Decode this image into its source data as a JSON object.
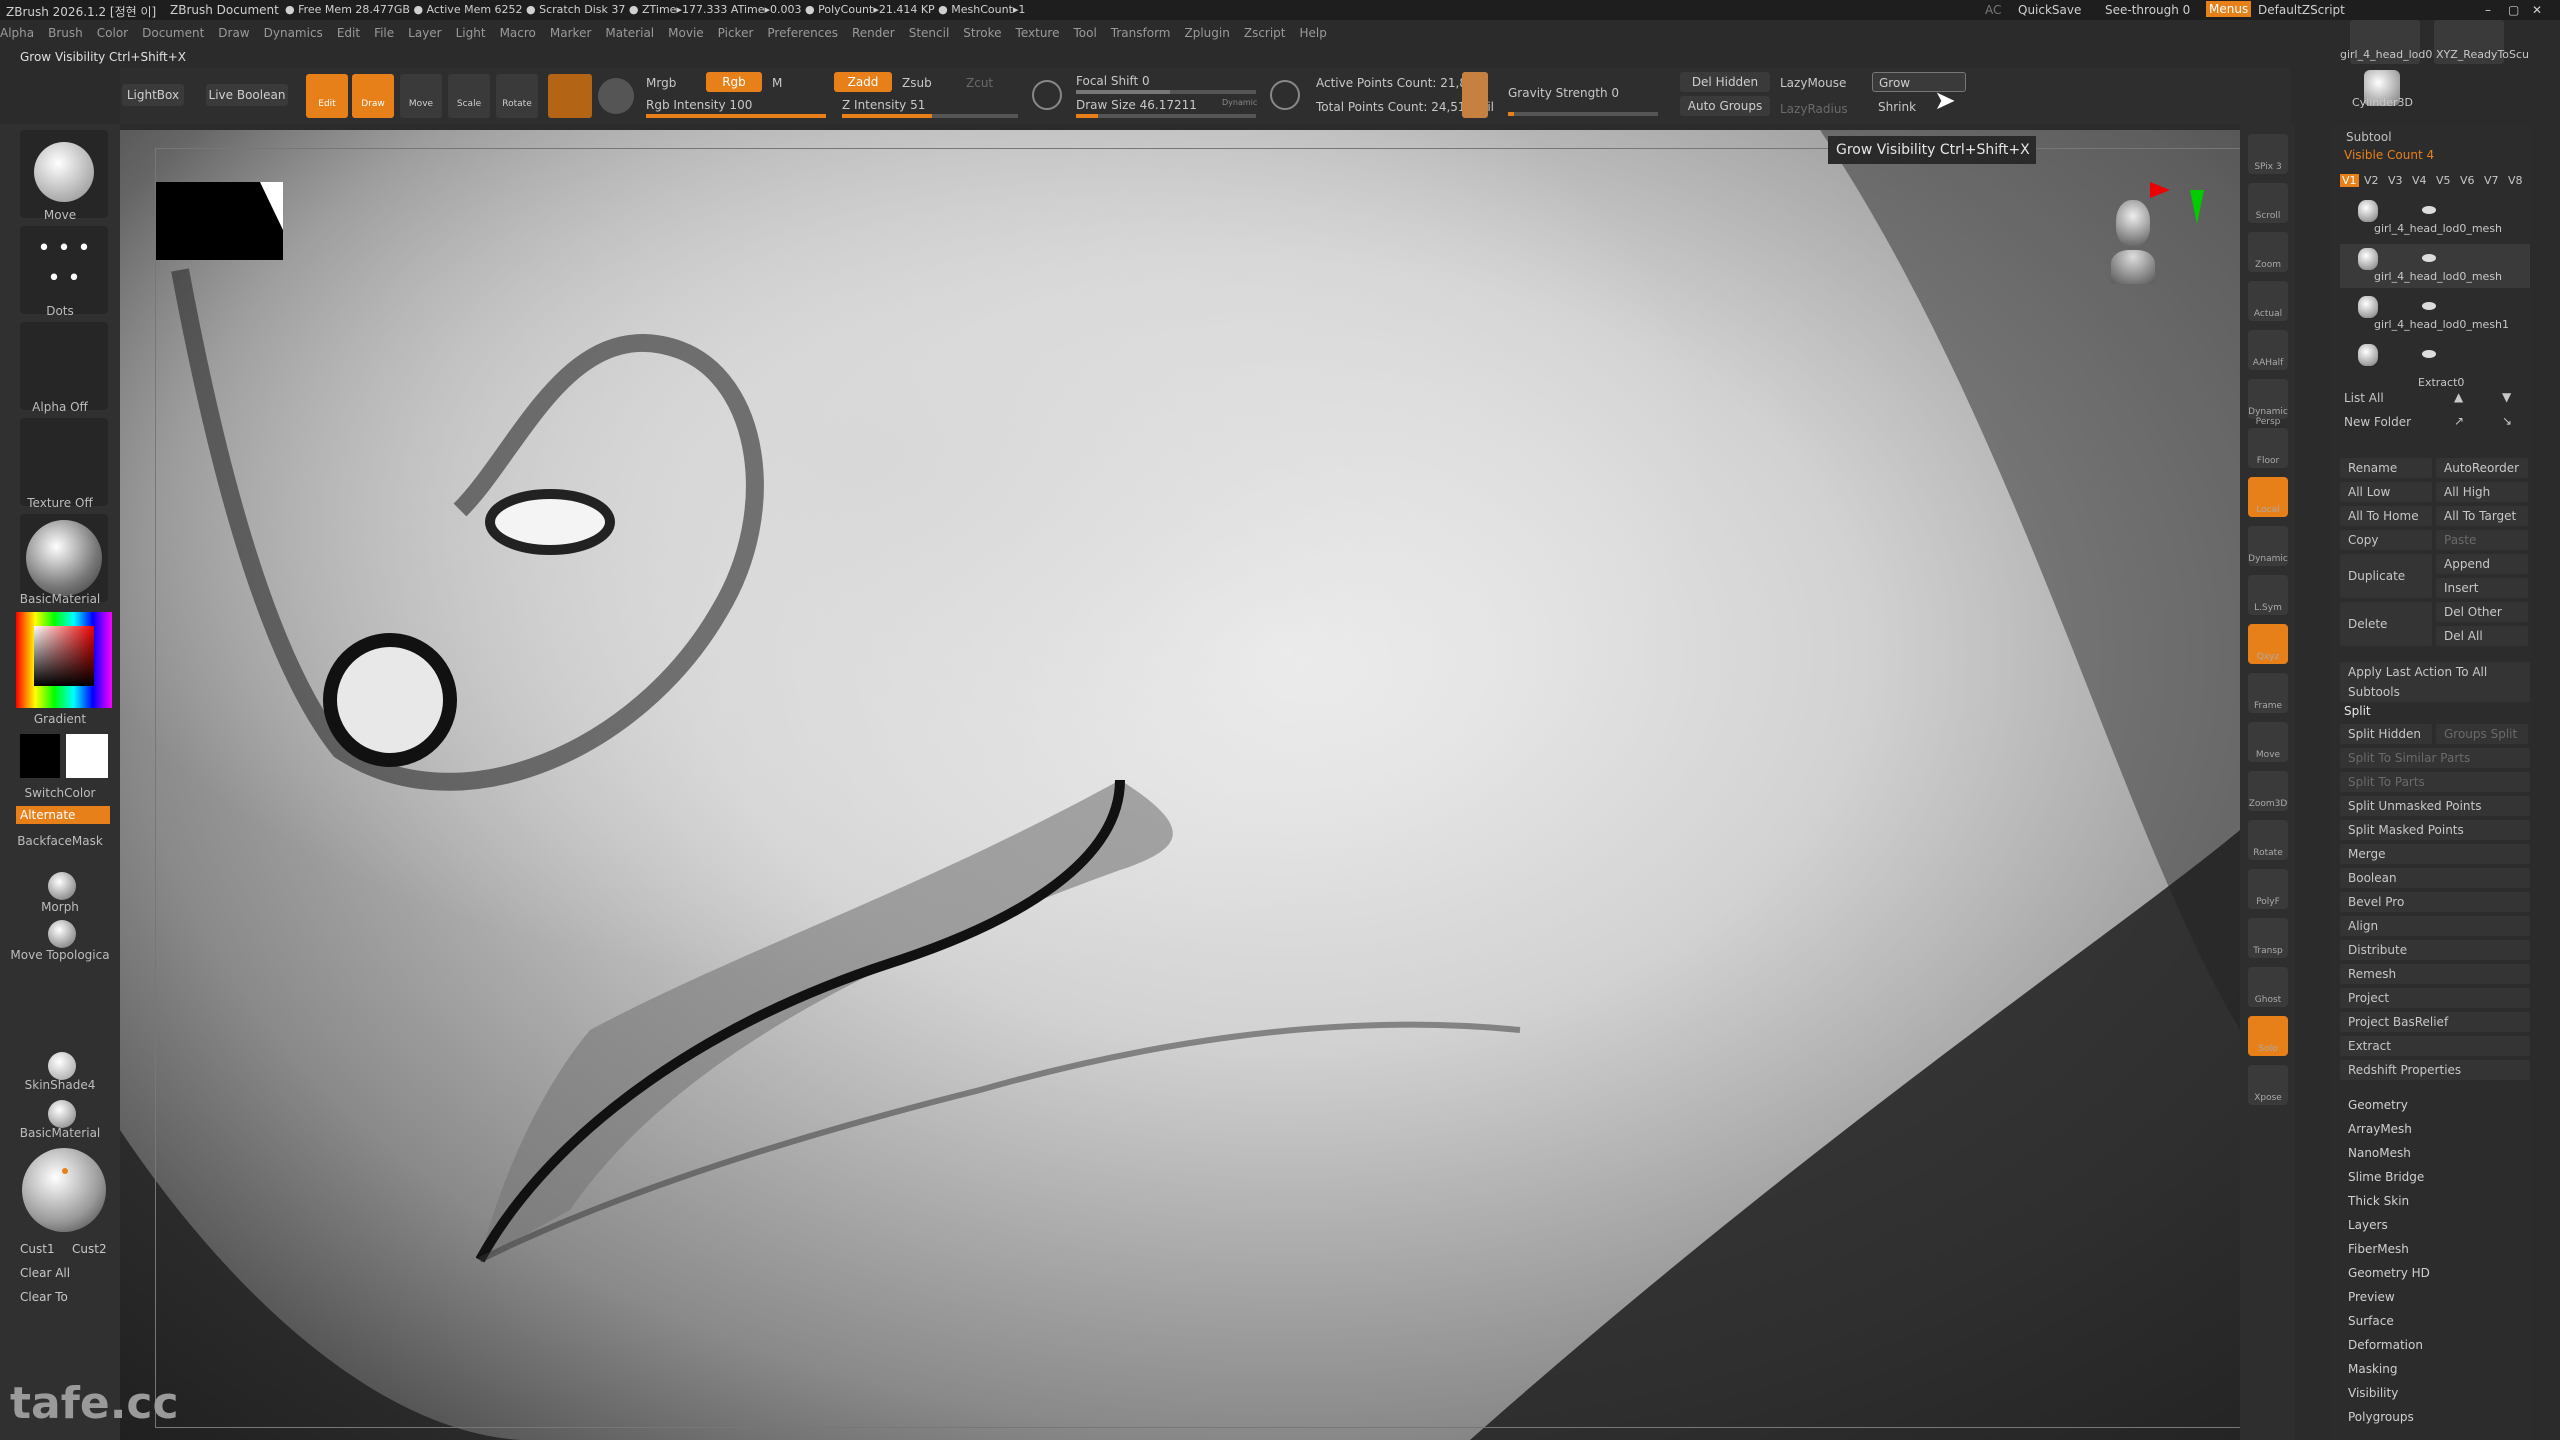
{
  "titlebar": {
    "app": "ZBrush 2026.1.2 [정현 이]",
    "doc": "ZBrush Document",
    "stats": "● Free Mem 28.477GB ● Active Mem 6252 ● Scratch Disk 37 ● ZTime▸177.333 ATime▸0.003 ● PolyCount▸21.414 KP ● MeshCount▸1",
    "ac": "AC",
    "quicksave": "QuickSave",
    "see_through": "See-through  0",
    "menus": "Menus",
    "script": "DefaultZScript"
  },
  "menubar": [
    "Alpha",
    "Brush",
    "Color",
    "Document",
    "Draw",
    "Dynamics",
    "Edit",
    "File",
    "Layer",
    "Light",
    "Macro",
    "Marker",
    "Material",
    "Movie",
    "Picker",
    "Preferences",
    "Render",
    "Stencil",
    "Stroke",
    "Texture",
    "Tool",
    "Transform",
    "Zplugin",
    "Zscript",
    "Help"
  ],
  "status": "Grow Visibility Ctrl+Shift+X",
  "shelf": {
    "lightbox": "LightBox",
    "live_boolean": "Live Boolean",
    "edit": "Edit",
    "draw": "Draw",
    "move": "Move",
    "scale": "Scale",
    "rotate": "Rotate",
    "mrgb": "Mrgb",
    "rgb": "Rgb",
    "m": "M",
    "rgb_intensity": "Rgb Intensity 100",
    "zadd": "Zadd",
    "zsub": "Zsub",
    "zcut": "Zcut",
    "z_intensity": "Z Intensity 51",
    "focal_shift": "Focal Shift 0",
    "draw_size": "Draw Size 46.17211",
    "dynamic": "Dynamic",
    "active_points": "Active Points Count: 21,828",
    "total_points": "Total Points Count: 24,511 Mil",
    "gravity": "Gravity Strength 0",
    "del_hidden": "Del Hidden",
    "auto_groups": "Auto Groups",
    "lazymouse": "LazyMouse",
    "lazyradius": "LazyRadius",
    "grow": "Grow",
    "shrink": "Shrink",
    "rgb_intensity_value": 100,
    "z_intensity_value": 51
  },
  "tooltip": "Grow Visibility   Ctrl+Shift+X",
  "lefttray": {
    "move": "Move",
    "dots": "Dots",
    "alpha": "Alpha Off",
    "texture": "Texture Off",
    "material": "BasicMaterial",
    "gradient": "Gradient",
    "switchcolor": "SwitchColor",
    "alternate": "Alternate",
    "backface": "BackfaceMask",
    "morph": "Morph",
    "move_topo": "Move Topologica",
    "skinshade": "SkinShade4",
    "basicmat2": "BasicMaterial",
    "cust1": "Cust1",
    "cust2": "Cust2",
    "clear_all": "Clear All",
    "clear_to": "Clear To"
  },
  "righttool": [
    "SPix 3",
    "Scroll",
    "Zoom",
    "Actual",
    "AAHalf",
    "Dynamic Persp",
    "Floor",
    "Local",
    "Dynamic",
    "L.Sym",
    "Qxyz",
    "Frame",
    "Move",
    "Zoom3D",
    "Rotate",
    "PolyF",
    "Transp",
    "Ghost",
    "Solo",
    "Xpose"
  ],
  "toolpanel": {
    "thumb1": "girl_4_head_lod0",
    "thumb2": "XYZ_ReadyToScu",
    "thumb3": "Cylinder3D",
    "subtool": "Subtool",
    "visible_count": "Visible Count 4",
    "versions": [
      "V1",
      "V2",
      "V3",
      "V4",
      "V5",
      "V6",
      "V7",
      "V8"
    ],
    "items": [
      "girl_4_head_lod0_mesh",
      "girl_4_head_lod0_mesh",
      "girl_4_head_lod0_mesh1",
      "Extract0"
    ],
    "list_all": "List All",
    "new_folder": "New Folder",
    "rename": "Rename",
    "autoreorder": "AutoReorder",
    "all_low": "All Low",
    "all_high": "All High",
    "all_to_home": "All To Home",
    "all_to_target": "All To Target",
    "copy": "Copy",
    "paste": "Paste",
    "duplicate": "Duplicate",
    "append": "Append",
    "insert": "Insert",
    "delete": "Delete",
    "del_other": "Del Other",
    "del_all": "Del All",
    "apply_last": "Apply Last Action To All Subtools",
    "split": "Split",
    "split_hidden": "Split Hidden",
    "groups_split": "Groups Split",
    "split_similar": "Split To Similar Parts",
    "split_parts": "Split To Parts",
    "split_unmasked": "Split Unmasked Points",
    "split_masked": "Split Masked Points",
    "tools": [
      "Merge",
      "Boolean",
      "Bevel Pro",
      "Align",
      "Distribute",
      "Remesh",
      "Project",
      "Project BasRelief",
      "Extract",
      "Redshift Properties"
    ],
    "sections": [
      "Geometry",
      "ArrayMesh",
      "NanoMesh",
      "Slime Bridge",
      "Thick Skin",
      "Layers",
      "FiberMesh",
      "Geometry HD",
      "Preview",
      "Surface",
      "Deformation",
      "Masking",
      "Visibility",
      "Polygroups"
    ]
  },
  "watermark": "tafe.cc"
}
